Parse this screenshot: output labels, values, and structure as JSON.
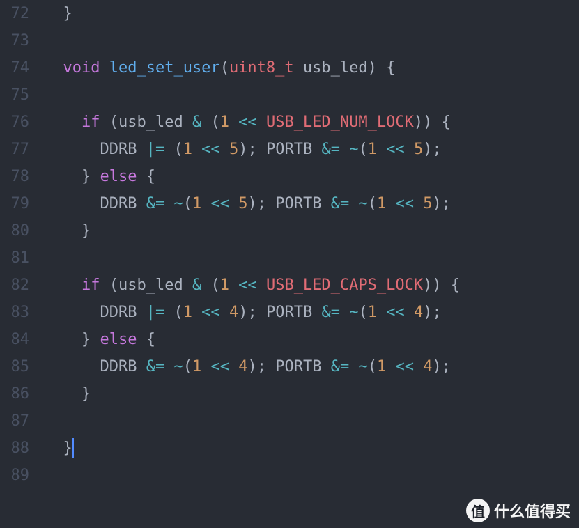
{
  "gutter": {
    "72": "72",
    "73": "73",
    "74": "74",
    "75": "75",
    "76": "76",
    "77": "77",
    "78": "78",
    "79": "79",
    "80": "80",
    "81": "81",
    "82": "82",
    "83": "83",
    "84": "84",
    "85": "85",
    "86": "86",
    "87": "87",
    "88": "88",
    "89": "89"
  },
  "tok": {
    "void": "void",
    "fn_name": "led_set_user",
    "uint8": "uint8_t",
    "param": "usb_led",
    "if": "if",
    "else": "else",
    "DDRB": "DDRB",
    "PORTB": "PORTB",
    "USB_NUM": "USB_LED_NUM_LOCK",
    "USB_CAPS": "USB_LED_CAPS_LOCK",
    "n1": "1",
    "n5": "5",
    "n4": "4",
    "amp": "&",
    "ls": "<<",
    "oreq": "|=",
    "andeq": "&=",
    "tilde": "~",
    "lp": "(",
    "rp": ")",
    "lb": "{",
    "rb": "}",
    "semi": ";",
    "sp1": " ",
    "sp2": "  ",
    "sp4": "    ",
    "sp6": "      "
  },
  "watermark": {
    "badge": "值",
    "text": "什么值得买"
  }
}
